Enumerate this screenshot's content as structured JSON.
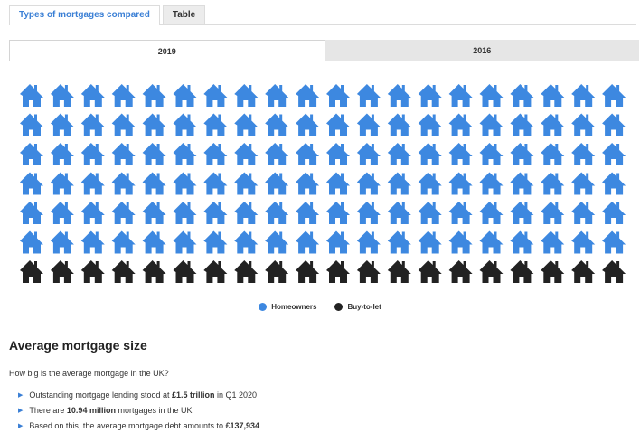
{
  "tabs": {
    "types_label": "Types of mortgages compared",
    "table_label": "Table"
  },
  "year_tabs": {
    "y2019": "2019",
    "y2016": "2016"
  },
  "waffle": {
    "columns": 20,
    "rows": 7,
    "homeowner_rows": 6,
    "buyto_rows": 1,
    "colors": {
      "homeowners": "#3d88e0",
      "buyto": "#222222"
    }
  },
  "legend": {
    "homeowners": "Homeowners",
    "buyto": "Buy-to-let"
  },
  "section": {
    "title": "Average mortgage size",
    "question": "How big is the average mortgage in the UK?"
  },
  "bullets": {
    "b1": {
      "pre": "Outstanding mortgage lending stood at ",
      "bold": "£1.5 trillion",
      "post": " in Q1 2020"
    },
    "b2": {
      "pre": "There are ",
      "bold": "10.94 million",
      "post": " mortgages in the UK"
    },
    "b3": {
      "pre": "Based on this, the average mortgage debt amounts to ",
      "bold": "£137,934",
      "post": ""
    }
  }
}
